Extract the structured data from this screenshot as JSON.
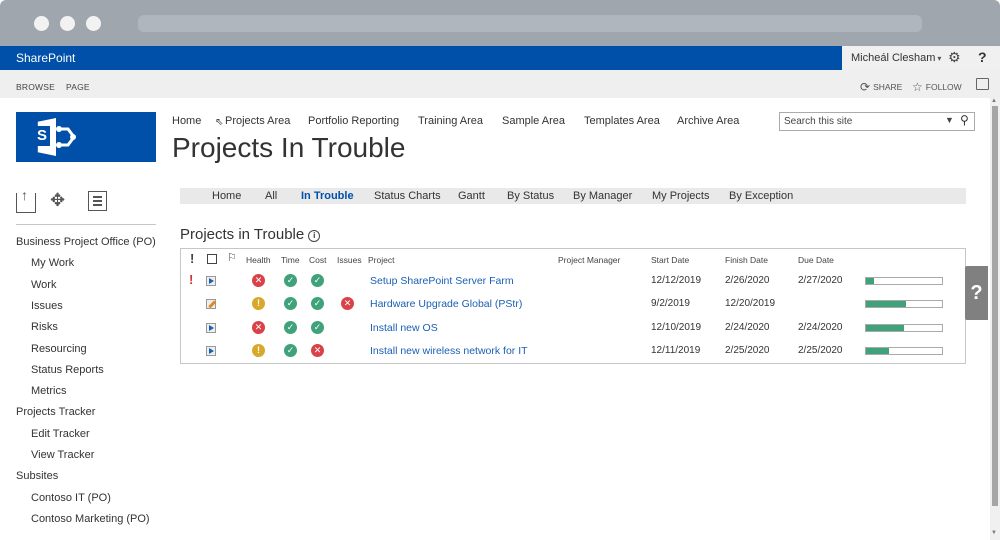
{
  "suite_bar": {
    "brand": "SharePoint",
    "user_name": "Micheál Clesham",
    "caret": "▾",
    "settings_icon": "gear-icon",
    "help_label": "?"
  },
  "ribbon": {
    "tabs": [
      "BROWSE",
      "PAGE"
    ],
    "share_label": "SHARE",
    "follow_label": "FOLLOW"
  },
  "top_nav": {
    "items": [
      "Home",
      "Projects Area",
      "Portfolio Reporting",
      "Training Area",
      "Sample Area",
      "Templates Area",
      "Archive Area"
    ]
  },
  "search": {
    "placeholder": "Search this site"
  },
  "page_title": "Projects In Trouble",
  "left_nav": {
    "items": [
      {
        "label": "Business Project Office (PO)",
        "level": 0
      },
      {
        "label": "My Work",
        "level": 1
      },
      {
        "label": "Work",
        "level": 1
      },
      {
        "label": "Issues",
        "level": 1
      },
      {
        "label": "Risks",
        "level": 1
      },
      {
        "label": "Resourcing",
        "level": 1
      },
      {
        "label": "Status Reports",
        "level": 1
      },
      {
        "label": "Metrics",
        "level": 1
      },
      {
        "label": "Projects Tracker",
        "level": 0
      },
      {
        "label": "Edit Tracker",
        "level": 1
      },
      {
        "label": "View Tracker",
        "level": 1
      },
      {
        "label": "Subsites",
        "level": 0
      },
      {
        "label": "Contoso IT (PO)",
        "level": 1
      },
      {
        "label": "Contoso Marketing (PO)",
        "level": 1
      }
    ]
  },
  "view_tabs": {
    "items": [
      "Home",
      "All",
      "In Trouble",
      "Status Charts",
      "Gantt",
      "By Status",
      "By Manager",
      "My Projects",
      "By Exception"
    ],
    "active": "In Trouble"
  },
  "section": {
    "title": "Projects in Trouble",
    "info_glyph": "i"
  },
  "table": {
    "headers": {
      "priority": "!",
      "health": "Health",
      "time": "Time",
      "cost": "Cost",
      "issues": "Issues",
      "project": "Project",
      "manager": "Project Manager",
      "start": "Start Date",
      "finish": "Finish Date",
      "due": "Due Date"
    },
    "rows": [
      {
        "priority": "!",
        "type": "project",
        "health": "bad",
        "time": "ok",
        "cost": "ok",
        "issues": "",
        "project": "Setup SharePoint Server Farm",
        "manager": "",
        "start": "12/12/2019",
        "finish": "2/26/2020",
        "due": "2/27/2020",
        "progress": 0.1
      },
      {
        "priority": "",
        "type": "edit",
        "health": "warn",
        "time": "ok",
        "cost": "ok",
        "issues": "bad",
        "project": "Hardware Upgrade Global (PStr)",
        "manager": "",
        "start": "9/2/2019",
        "finish": "12/20/2019",
        "due": "",
        "progress": 0.52
      },
      {
        "priority": "",
        "type": "project",
        "health": "bad",
        "time": "ok",
        "cost": "ok",
        "issues": "",
        "project": "Install new OS",
        "manager": "",
        "start": "12/10/2019",
        "finish": "2/24/2020",
        "due": "2/24/2020",
        "progress": 0.5
      },
      {
        "priority": "",
        "type": "project",
        "health": "warn",
        "time": "ok",
        "cost": "bad",
        "issues": "",
        "project": "Install new wireless network for IT",
        "manager": "",
        "start": "12/11/2019",
        "finish": "2/25/2020",
        "due": "2/25/2020",
        "progress": 0.3
      }
    ],
    "status_glyphs": {
      "ok": "✓",
      "bad": "✕",
      "warn": "!"
    }
  },
  "help_tab": "?",
  "colors": {
    "brand_blue": "#0050aa",
    "ok_green": "#3fa27a",
    "bad_red": "#d94248",
    "warn_yellow": "#d8a82a",
    "link_blue": "#1a5fb4"
  }
}
